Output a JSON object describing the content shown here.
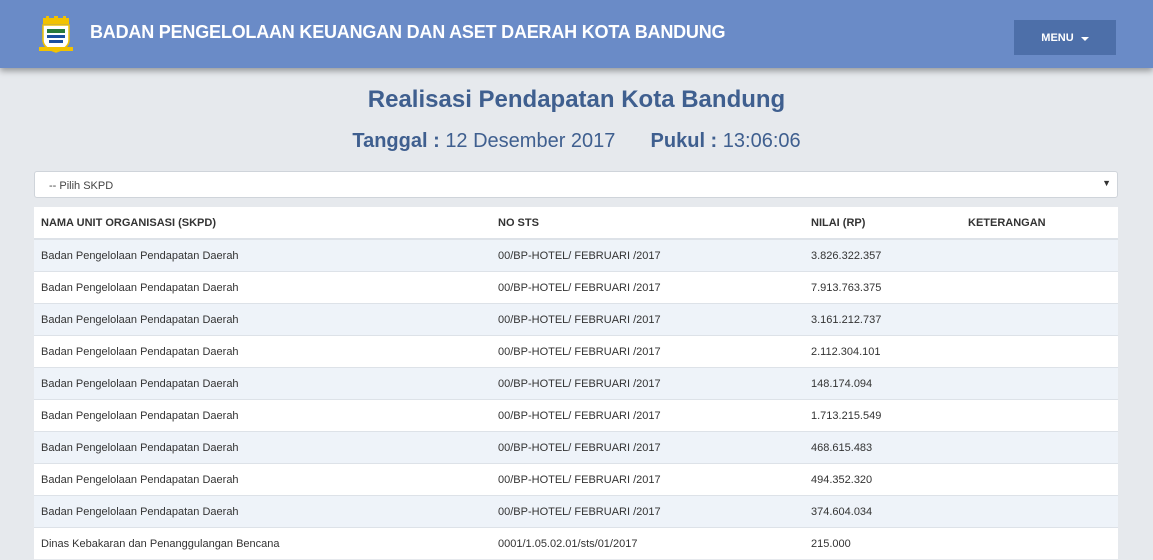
{
  "header": {
    "title": "BADAN PENGELOLAAN KEUANGAN DAN ASET DAERAH KOTA BANDUNG",
    "menu_label": "MENU"
  },
  "main": {
    "title": "Realisasi Pendapatan Kota Bandung",
    "date_label": "Tanggal :",
    "date_value": "12 Desember 2017",
    "time_label": "Pukul :",
    "time_value": "13:06:06",
    "skpd_select": {
      "selected": "-- Pilih SKPD"
    }
  },
  "table": {
    "columns": [
      "NAMA UNIT ORGANISASI (SKPD)",
      "NO STS",
      "NILAI (RP)",
      "KETERANGAN"
    ],
    "rows": [
      [
        "Badan Pengelolaan Pendapatan Daerah",
        "00/BP-HOTEL/ FEBRUARI /2017",
        "3.826.322.357",
        ""
      ],
      [
        "Badan Pengelolaan Pendapatan Daerah",
        "00/BP-HOTEL/ FEBRUARI /2017",
        "7.913.763.375",
        ""
      ],
      [
        "Badan Pengelolaan Pendapatan Daerah",
        "00/BP-HOTEL/ FEBRUARI /2017",
        "3.161.212.737",
        ""
      ],
      [
        "Badan Pengelolaan Pendapatan Daerah",
        "00/BP-HOTEL/ FEBRUARI /2017",
        "2.112.304.101",
        ""
      ],
      [
        "Badan Pengelolaan Pendapatan Daerah",
        "00/BP-HOTEL/ FEBRUARI /2017",
        "148.174.094",
        ""
      ],
      [
        "Badan Pengelolaan Pendapatan Daerah",
        "00/BP-HOTEL/ FEBRUARI /2017",
        "1.713.215.549",
        ""
      ],
      [
        "Badan Pengelolaan Pendapatan Daerah",
        "00/BP-HOTEL/ FEBRUARI /2017",
        "468.615.483",
        ""
      ],
      [
        "Badan Pengelolaan Pendapatan Daerah",
        "00/BP-HOTEL/ FEBRUARI /2017",
        "494.352.320",
        ""
      ],
      [
        "Badan Pengelolaan Pendapatan Daerah",
        "00/BP-HOTEL/ FEBRUARI /2017",
        "374.604.034",
        ""
      ],
      [
        "Dinas Kebakaran dan Penanggulangan Bencana",
        "0001/1.05.02.01/sts/01/2017",
        "215.000",
        ""
      ]
    ]
  },
  "colors": {
    "navbar": "#6a8bc7",
    "menu_button": "#4d6fa9",
    "title_text": "#3f5f8f",
    "row_stripe": "#eef3f9"
  },
  "icons": {
    "logo": "bandung-city-emblem-icon",
    "select_arrow": "triangle-down-icon"
  }
}
